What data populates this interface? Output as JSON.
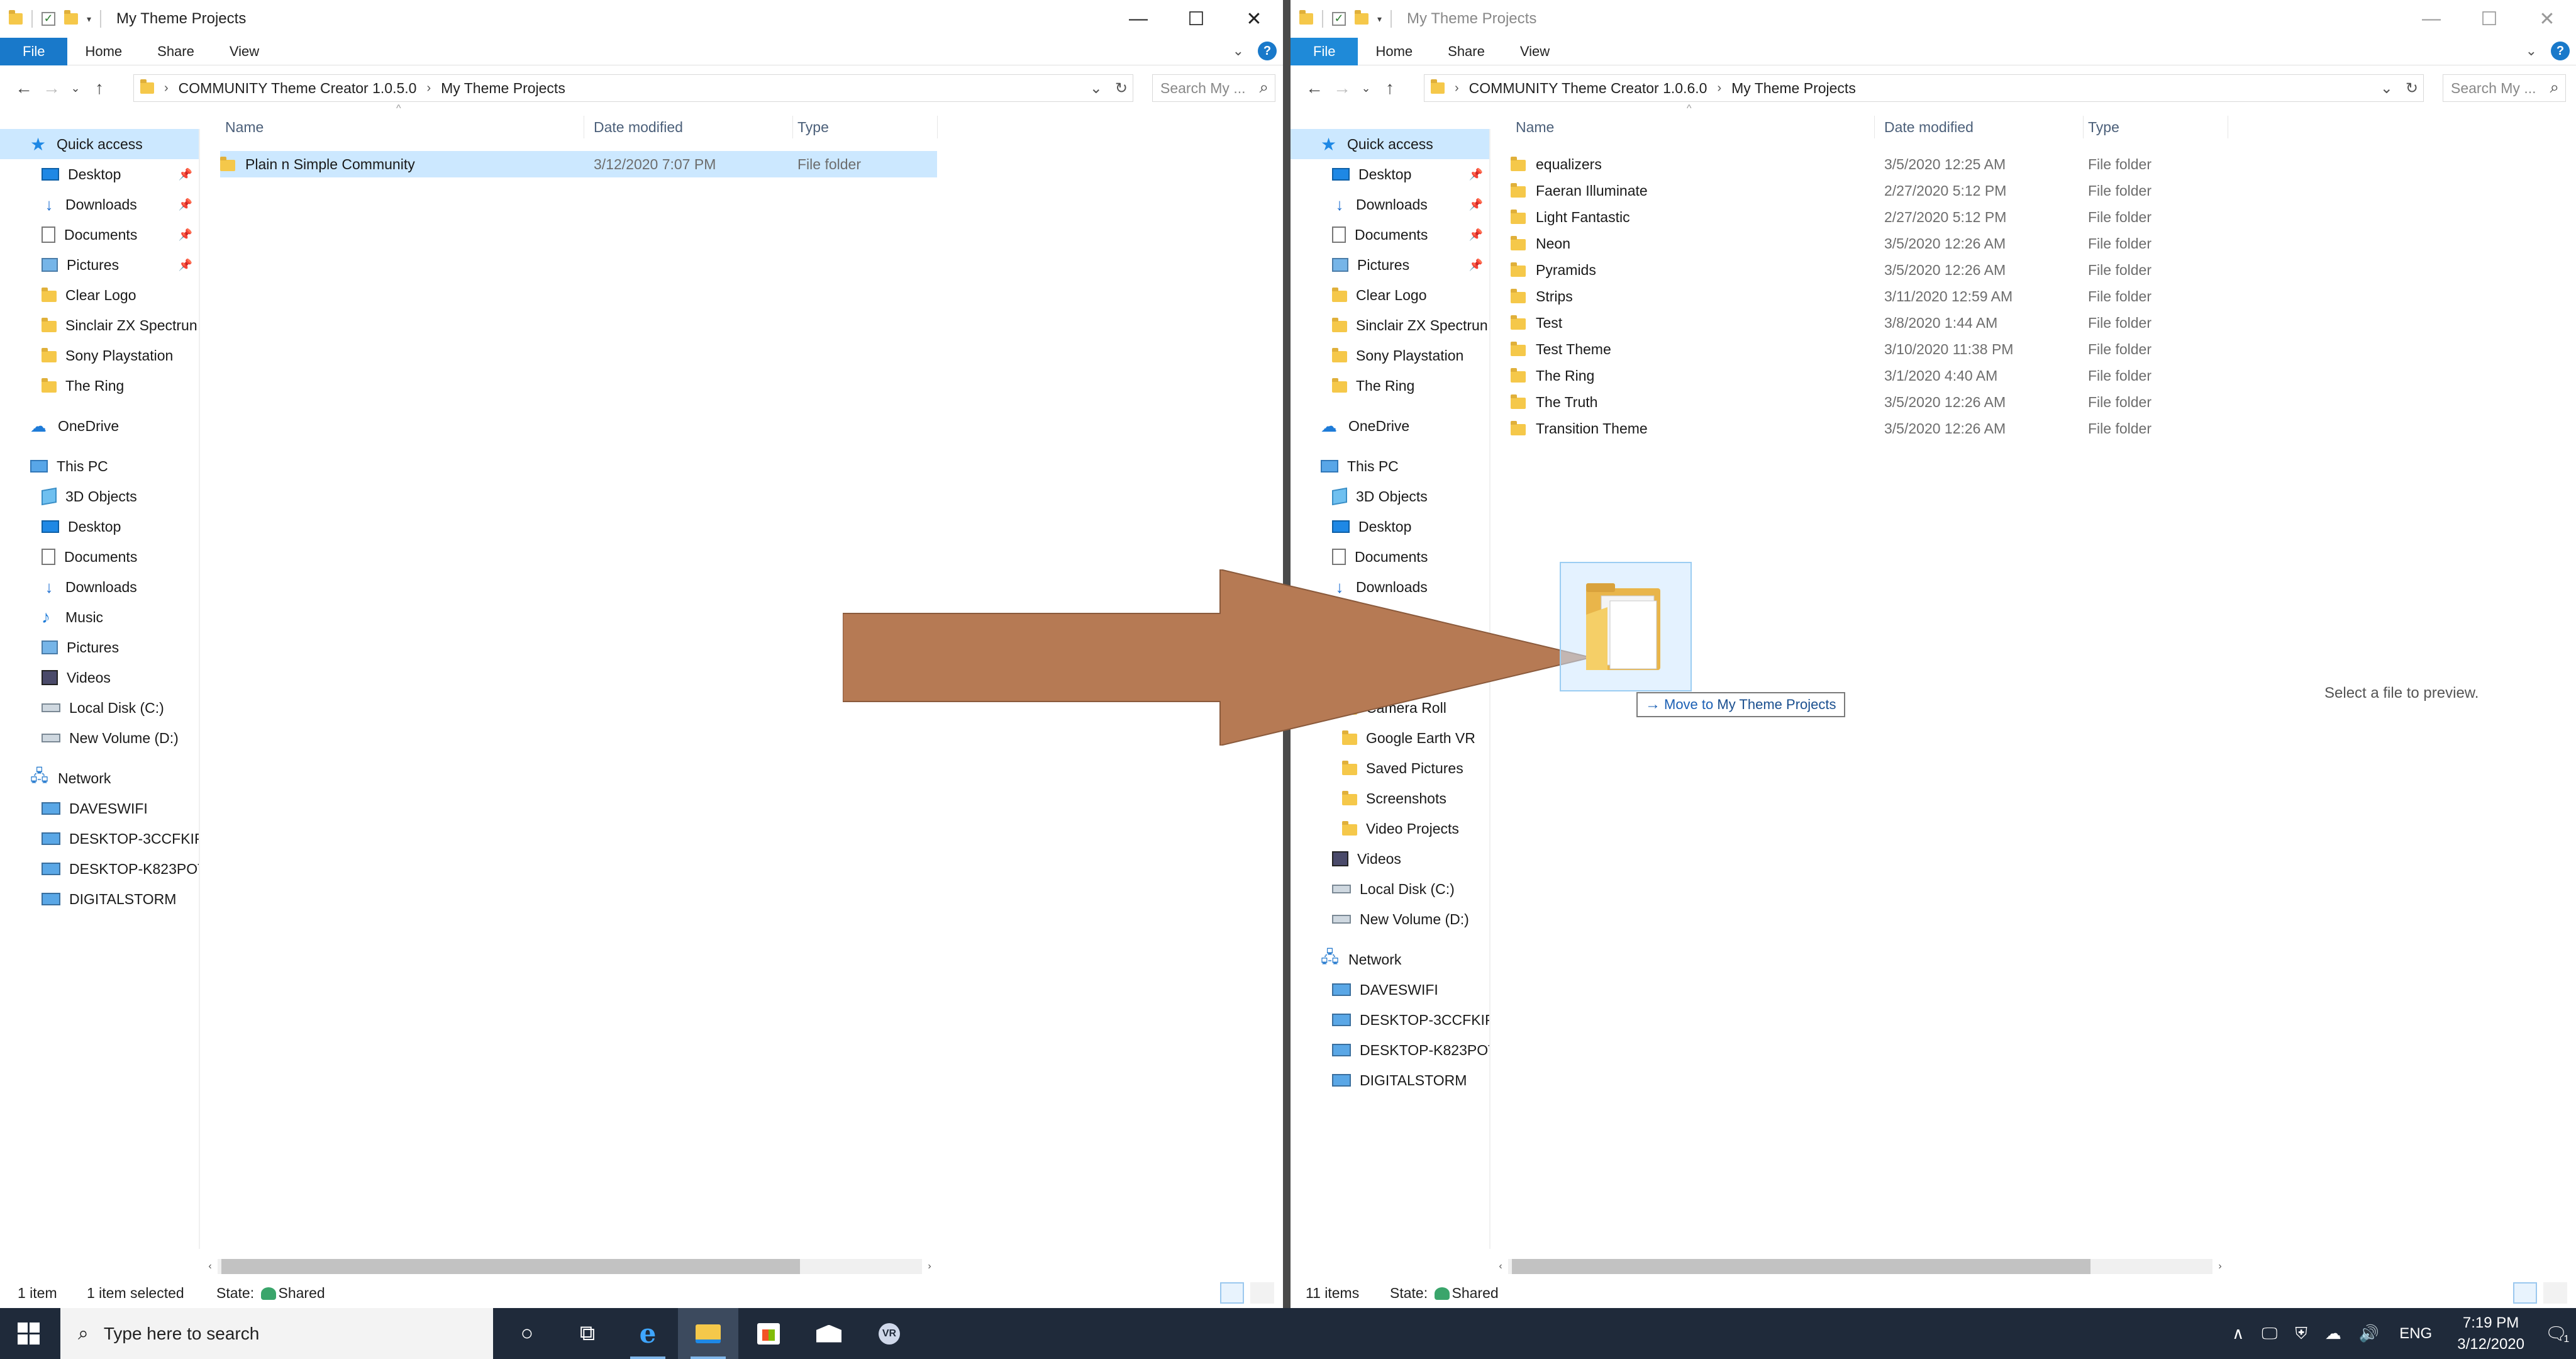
{
  "colors": {
    "accent": "#1979ca",
    "selection": "#cce8ff",
    "arrow": "#b67a54",
    "taskbar": "#1f2a3a"
  },
  "left": {
    "title": "My Theme Projects",
    "ribbon": {
      "file": "File",
      "home": "Home",
      "share": "Share",
      "view": "View"
    },
    "breadcrumbs": [
      "COMMUNITY Theme Creator 1.0.5.0",
      "My Theme Projects"
    ],
    "search_placeholder": "Search My ...",
    "nav": {
      "quick_access": "Quick access",
      "quick": [
        {
          "label": "Desktop",
          "icon": "desktop-icon",
          "pinned": true
        },
        {
          "label": "Downloads",
          "icon": "downloads-icon",
          "pinned": true
        },
        {
          "label": "Documents",
          "icon": "documents-icon",
          "pinned": true
        },
        {
          "label": "Pictures",
          "icon": "pictures-icon",
          "pinned": true
        },
        {
          "label": "Clear Logo",
          "icon": "folder-icon",
          "pinned": false
        },
        {
          "label": "Sinclair ZX Spectrun",
          "icon": "folder-icon",
          "pinned": false
        },
        {
          "label": "Sony Playstation",
          "icon": "folder-icon",
          "pinned": false
        },
        {
          "label": "The Ring",
          "icon": "folder-icon",
          "pinned": false
        }
      ],
      "onedrive": "OneDrive",
      "this_pc": "This PC",
      "pc": [
        "3D Objects",
        "Desktop",
        "Documents",
        "Downloads",
        "Music",
        "Pictures",
        "Videos",
        "Local Disk (C:)",
        "New Volume (D:)"
      ],
      "network": "Network",
      "net": [
        "DAVESWIFI",
        "DESKTOP-3CCFKIP",
        "DESKTOP-K823POT",
        "DIGITALSTORM"
      ]
    },
    "columns": {
      "name": "Name",
      "date": "Date modified",
      "type": "Type"
    },
    "files": [
      {
        "name": "Plain n Simple Community",
        "date": "3/12/2020 7:07 PM",
        "type": "File folder"
      }
    ],
    "status": {
      "count": "1 item",
      "selected": "1 item selected",
      "state_label": "State:",
      "state": "Shared"
    }
  },
  "right": {
    "title": "My Theme Projects",
    "ribbon": {
      "file": "File",
      "home": "Home",
      "share": "Share",
      "view": "View"
    },
    "breadcrumbs": [
      "COMMUNITY Theme Creator 1.0.6.0",
      "My Theme Projects"
    ],
    "search_placeholder": "Search My ...",
    "nav": {
      "quick_access": "Quick access",
      "quick": [
        "Desktop",
        "Downloads",
        "Documents",
        "Pictures",
        "Clear Logo",
        "Sinclair ZX Spectrun",
        "Sony Playstation",
        "The Ring"
      ],
      "onedrive": "OneDrive",
      "this_pc": "This PC",
      "pc_top": [
        "3D Objects",
        "Desktop",
        "Documents",
        "Downloads"
      ],
      "pictures_sub": [
        "Camera Roll",
        "Google Earth VR",
        "Saved Pictures",
        "Screenshots",
        "Video Projects"
      ],
      "pc_bottom": [
        "Videos",
        "Local Disk (C:)",
        "New Volume (D:)"
      ],
      "network": "Network",
      "net": [
        "DAVESWIFI",
        "DESKTOP-3CCFKIP",
        "DESKTOP-K823POT",
        "DIGITALSTORM"
      ]
    },
    "columns": {
      "name": "Name",
      "date": "Date modified",
      "type": "Type"
    },
    "files": [
      {
        "name": "equalizers",
        "date": "3/5/2020 12:25 AM",
        "type": "File folder"
      },
      {
        "name": "Faeran Illuminate",
        "date": "2/27/2020 5:12 PM",
        "type": "File folder"
      },
      {
        "name": "Light Fantastic",
        "date": "2/27/2020 5:12 PM",
        "type": "File folder"
      },
      {
        "name": "Neon",
        "date": "3/5/2020 12:26 AM",
        "type": "File folder"
      },
      {
        "name": "Pyramids",
        "date": "3/5/2020 12:26 AM",
        "type": "File folder"
      },
      {
        "name": "Strips",
        "date": "3/11/2020 12:59 AM",
        "type": "File folder"
      },
      {
        "name": "Test",
        "date": "3/8/2020 1:44 AM",
        "type": "File folder"
      },
      {
        "name": "Test Theme",
        "date": "3/10/2020 11:38 PM",
        "type": "File folder"
      },
      {
        "name": "The Ring",
        "date": "3/1/2020 4:40 AM",
        "type": "File folder"
      },
      {
        "name": "The Truth",
        "date": "3/5/2020 12:26 AM",
        "type": "File folder"
      },
      {
        "name": "Transition Theme",
        "date": "3/5/2020 12:26 AM",
        "type": "File folder"
      }
    ],
    "preview": "Select a file to preview.",
    "status": {
      "count": "11 items",
      "state_label": "State:",
      "state": "Shared"
    }
  },
  "drag": {
    "prefix": "Move to",
    "destination": "My Theme Projects"
  },
  "taskbar": {
    "search_placeholder": "Type here to search",
    "lang": "ENG",
    "time": "7:19 PM",
    "date": "3/12/2020",
    "notification_count": "1"
  }
}
